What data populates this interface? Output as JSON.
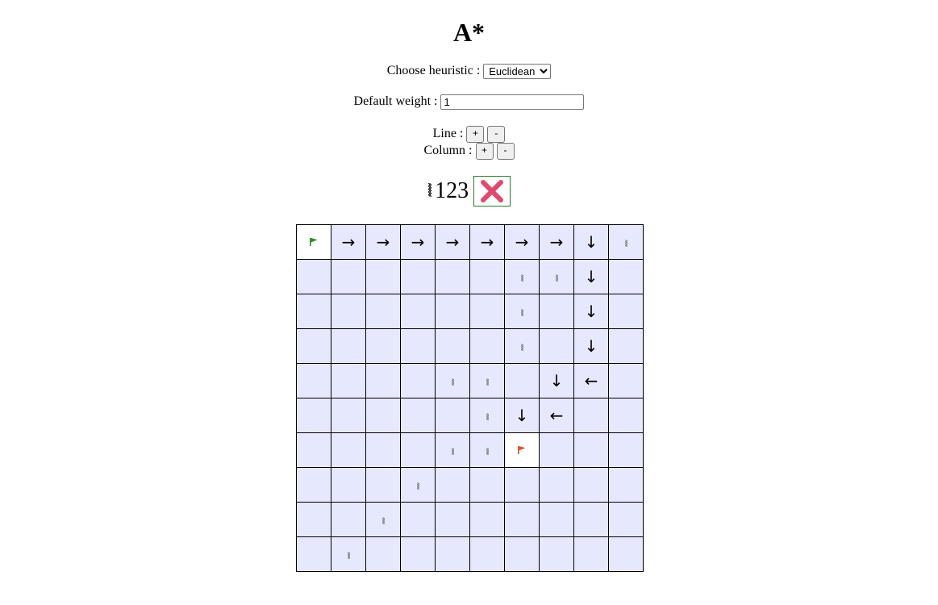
{
  "title": "A*",
  "heuristic": {
    "label": "Choose heuristic :",
    "selected": "Euclidean"
  },
  "weight": {
    "label": "Default weight :",
    "value": "1"
  },
  "line": {
    "label": "Line :",
    "plus": "+",
    "minus": "-"
  },
  "column": {
    "label": "Column :",
    "plus": "+",
    "minus": "-"
  },
  "palette": {
    "wall_glyph": "⦚⦚",
    "number": "123",
    "erase_icon": "close-icon",
    "erase_color": "#e2486a"
  },
  "colors": {
    "cell": "#e6e9fd",
    "start_flag": "#2e8b2e",
    "goal_flag": "#e8502a"
  },
  "grid": [
    [
      "start",
      "→",
      "→",
      "→",
      "→",
      "→",
      "→",
      "→",
      "↓",
      "wall"
    ],
    [
      "",
      "",
      "",
      "",
      "",
      "",
      "wall",
      "wall",
      "↓",
      ""
    ],
    [
      "",
      "",
      "",
      "",
      "",
      "",
      "wall",
      "",
      "↓",
      ""
    ],
    [
      "",
      "",
      "",
      "",
      "",
      "",
      "wall",
      "",
      "↓",
      ""
    ],
    [
      "",
      "",
      "",
      "",
      "wall",
      "wall",
      "",
      "↓",
      "←",
      ""
    ],
    [
      "",
      "",
      "",
      "",
      "",
      "wall",
      "↓",
      "←",
      "",
      ""
    ],
    [
      "",
      "",
      "",
      "",
      "wall",
      "wall",
      "goal",
      "",
      "",
      ""
    ],
    [
      "",
      "",
      "",
      "wall",
      "",
      "",
      "",
      "",
      "",
      ""
    ],
    [
      "",
      "",
      "wall",
      "",
      "",
      "",
      "",
      "",
      "",
      ""
    ],
    [
      "",
      "wall",
      "",
      "",
      "",
      "",
      "",
      "",
      "",
      ""
    ]
  ]
}
